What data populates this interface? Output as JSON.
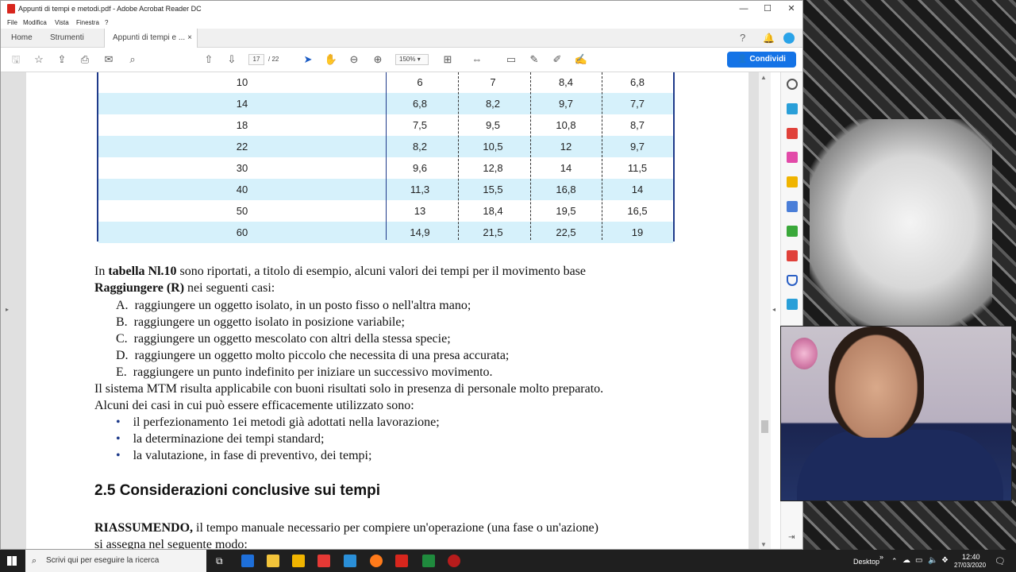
{
  "window": {
    "title": "Appunti di tempi e metodi.pdf - Adobe Acrobat Reader DC",
    "min": "—",
    "max": "☐",
    "close": "✕"
  },
  "menu": [
    "File",
    "Modifica",
    "Vista",
    "Finestra",
    "?"
  ],
  "tabs": {
    "home": "Home",
    "tools": "Strumenti",
    "doc": "Appunti di tempi e ...",
    "close": "×"
  },
  "toolbar": {
    "page_current": "17",
    "page_total": "/ 22",
    "zoom": "150%",
    "share": "Condividi"
  },
  "table_rows": [
    [
      "10",
      "6",
      "7",
      "8,4",
      "6,8"
    ],
    [
      "14",
      "6,8",
      "8,2",
      "9,7",
      "7,7"
    ],
    [
      "18",
      "7,5",
      "9,5",
      "10,8",
      "8,7"
    ],
    [
      "22",
      "8,2",
      "10,5",
      "12",
      "9,7"
    ],
    [
      "30",
      "9,6",
      "12,8",
      "14",
      "11,5"
    ],
    [
      "40",
      "11,3",
      "15,5",
      "16,8",
      "14"
    ],
    [
      "50",
      "13",
      "18,4",
      "19,5",
      "16,5"
    ],
    [
      "60",
      "14,9",
      "21,5",
      "22,5",
      "19"
    ]
  ],
  "text": {
    "p1_a": "In ",
    "p1_b": "tabella Nl.10",
    "p1_c": " sono riportati, a titolo di esempio, alcuni valori dei tempi per il movimento base",
    "p2_a": "Raggiungere (R)",
    "p2_b": " nei seguenti casi:",
    "list": [
      {
        "k": "A.",
        "t": "raggiungere un oggetto isolato, in un posto fisso o nell'altra mano;"
      },
      {
        "k": "B.",
        "t": "raggiungere un oggetto isolato in posizione variabile;"
      },
      {
        "k": "C.",
        "t": "raggiungere un oggetto mescolato con altri della stessa specie;"
      },
      {
        "k": "D.",
        "t": "raggiungere un oggetto molto piccolo che necessita di una presa accurata;"
      },
      {
        "k": "E.",
        "t": "raggiungere un punto indefinito per iniziare un successivo movimento."
      }
    ],
    "p3": "Il sistema MTM risulta applicabile con buoni risultati solo in presenza di personale molto preparato.",
    "p4": "Alcuni dei casi in cui può essere efficacemente utilizzato sono:",
    "bullets": [
      "il perfezionamento 1ei metodi già adottati nella lavorazione;",
      "la determinazione dei tempi standard;",
      "la valutazione, in fase di preventivo, dei tempi;"
    ],
    "bullet_char": "•",
    "heading": "2.5 Considerazioni conclusive sui tempi",
    "p5_a": "RIASSUMENDO,",
    "p5_b": " il tempo manuale necessario per compiere un'operazione (una fase o un'azione)",
    "p6": "si assegna nel seguente modo:"
  },
  "taskbar": {
    "search_placeholder": "Scrivi qui per eseguire la ricerca",
    "desktop": "Desktop",
    "time": "12:40",
    "date": "27/03/2020"
  },
  "colors": {
    "accent": "#1473e6",
    "table_stripe": "#d6f1fb",
    "table_border": "#1e3a8a"
  }
}
